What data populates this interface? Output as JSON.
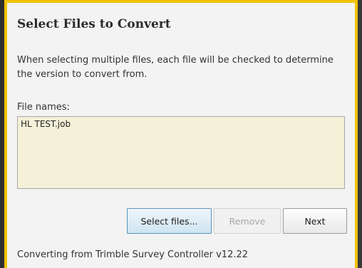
{
  "dialog": {
    "title": "Select Files to Convert",
    "description": "When selecting multiple files, each file will be checked to determine the version to convert from.",
    "file_names_label": "File names:",
    "file_names_value": "HL TEST.job",
    "buttons": {
      "select_files": "Select files...",
      "remove": "Remove",
      "next": "Next"
    },
    "status": "Converting from Trimble Survey Controller v12.22"
  },
  "colors": {
    "accent_border": "#f2c200",
    "panel_background": "#f3f3f3",
    "file_list_background": "#f4f1d8"
  }
}
